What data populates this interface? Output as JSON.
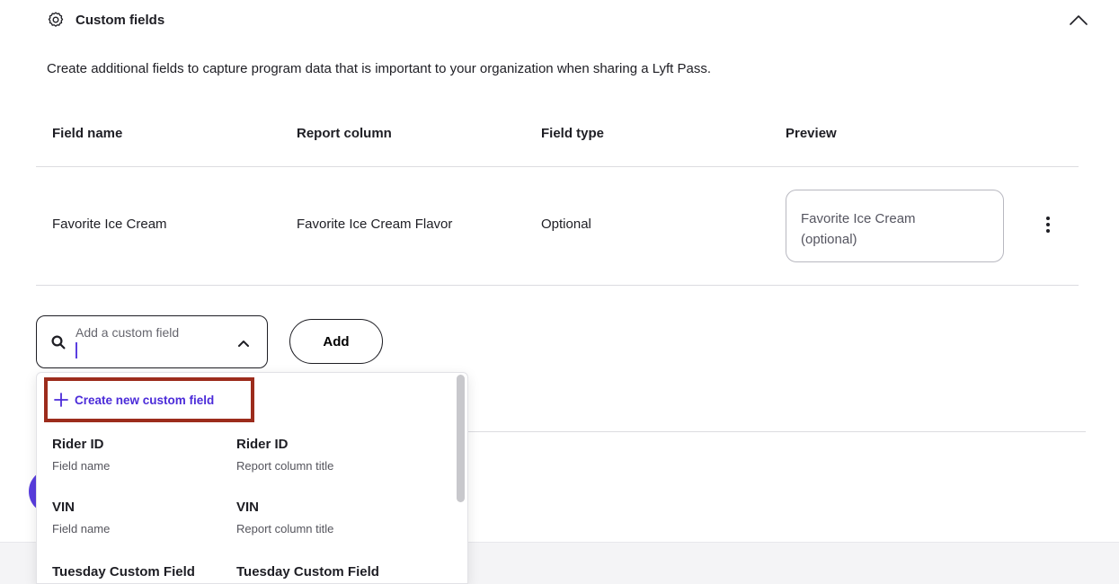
{
  "section": {
    "title": "Custom fields",
    "description": "Create additional fields to capture program data that is important to your organization when sharing a Lyft Pass."
  },
  "table": {
    "headers": [
      "Field name",
      "Report column",
      "Field type",
      "Preview"
    ],
    "rows": [
      {
        "field_name": "Favorite Ice Cream",
        "report_column": "Favorite Ice Cream Flavor",
        "field_type": "Optional",
        "preview_line1": "Favorite Ice Cream",
        "preview_line2": "(optional)"
      }
    ]
  },
  "add_field": {
    "placeholder": "Add a custom field",
    "value": "",
    "add_button": "Add"
  },
  "dropdown": {
    "create_label": "Create new custom field",
    "options": [
      {
        "name": "Rider ID",
        "name_caption": "Field name",
        "report": "Rider ID",
        "report_caption": "Report column title"
      },
      {
        "name": "VIN",
        "name_caption": "Field name",
        "report": "VIN",
        "report_caption": "Report column title"
      },
      {
        "name": "Tuesday Custom Field",
        "name_caption": "",
        "report": "Tuesday Custom Field",
        "report_caption": ""
      }
    ]
  },
  "colors": {
    "accent": "#5a3ee0",
    "link": "#4b2bd9",
    "highlight_border": "#9c2c1c"
  },
  "icons": {
    "section_icon": "gear-icon",
    "collapse": "chevron-up-icon",
    "row_menu": "kebab-menu-icon",
    "search": "search-icon",
    "dropdown_toggle": "chevron-up-icon",
    "create": "plus-icon"
  }
}
